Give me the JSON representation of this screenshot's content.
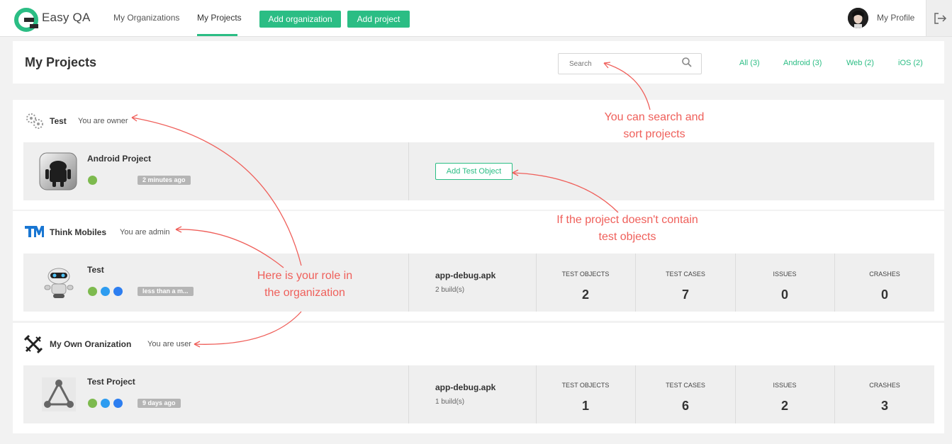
{
  "app": {
    "name": "Easy QA"
  },
  "nav": {
    "my_organizations": "My Organizations",
    "my_projects": "My Projects",
    "add_organization": "Add organization",
    "add_project": "Add project",
    "profile": "My Profile"
  },
  "header": {
    "title": "My Projects",
    "search_placeholder": "Search",
    "filters": [
      "All (3)",
      "Android (3)",
      "Web (2)",
      "iOS (2)"
    ]
  },
  "organizations": [
    {
      "name": "Test",
      "role": "You are owner",
      "project": {
        "name": "Android Project",
        "time": "2 minutes ago",
        "platforms": [
          "android"
        ],
        "add_test_object_label": "Add Test Object"
      }
    },
    {
      "name": "Think Mobiles",
      "role": "You are admin",
      "project": {
        "name": "Test",
        "time": "less than a m...",
        "platforms": [
          "android",
          "ios",
          "web"
        ],
        "build_name": "app-debug.apk",
        "build_count": "2 build(s)",
        "stats": [
          {
            "label": "TEST OBJECTS",
            "value": "2"
          },
          {
            "label": "TEST CASES",
            "value": "7"
          },
          {
            "label": "ISSUES",
            "value": "0"
          },
          {
            "label": "CRASHES",
            "value": "0"
          }
        ]
      }
    },
    {
      "name": "My Own Oranization",
      "role": "You are user",
      "project": {
        "name": "Test Project",
        "time": "9 days ago",
        "platforms": [
          "android",
          "ios",
          "web"
        ],
        "build_name": "app-debug.apk",
        "build_count": "1 build(s)",
        "stats": [
          {
            "label": "TEST OBJECTS",
            "value": "1"
          },
          {
            "label": "TEST CASES",
            "value": "6"
          },
          {
            "label": "ISSUES",
            "value": "2"
          },
          {
            "label": "CRASHES",
            "value": "3"
          }
        ]
      }
    }
  ],
  "annotations": {
    "search_line1": "You can search and",
    "search_line2": "sort projects",
    "role_line1": "Here is your role in",
    "role_line2": "the organization",
    "empty_line1": "If the project doesn't contain",
    "empty_line2": "test objects"
  },
  "colors": {
    "accent": "#2bbd84",
    "annotation": "#ef5f5a",
    "android": "#7dba4e",
    "ios": "#2d9cf0",
    "web": "#2d7ef0"
  }
}
